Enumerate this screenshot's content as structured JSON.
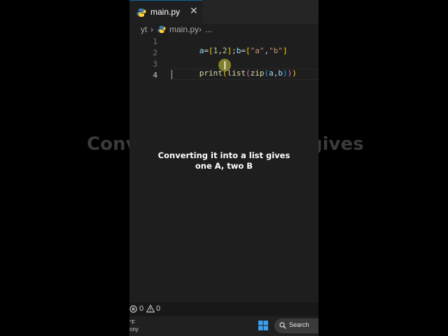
{
  "overlay": {
    "bg_caption_left": "Conv",
    "bg_caption_right": "gives",
    "caption_line1": "Converting it into a list gives",
    "caption_line2": "one A, two B"
  },
  "editor_tab": {
    "filename": "main.py",
    "close_glyph": "✕"
  },
  "breadcrumb": {
    "folder": "yt",
    "file": "main.py",
    "separator": "›",
    "more": "..."
  },
  "code": {
    "line_numbers": [
      "1",
      "2",
      "3",
      "4"
    ],
    "line1": "a=[1,2];b=[\"a\",\"b\"]",
    "line3": "print(list(zip(a,b)))"
  },
  "status_bar": {
    "errors": "0",
    "warnings": "0"
  },
  "taskbar": {
    "weather_temp": "°F",
    "weather_desc": "nny",
    "search_label": "Search"
  },
  "colors": {
    "editor_bg": "#1e1e1e",
    "keyword_fn": "#dcdcaa",
    "variable": "#9cdcfe",
    "number": "#b5cea8",
    "string": "#ce9178"
  },
  "icons": [
    "python-icon",
    "close-icon",
    "error-icon",
    "warning-icon",
    "windows-start-icon",
    "search-icon"
  ]
}
